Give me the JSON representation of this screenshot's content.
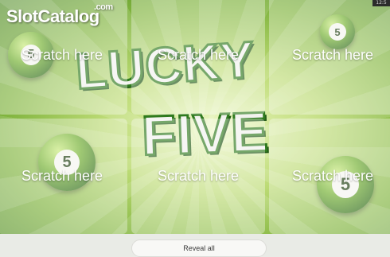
{
  "game": {
    "title_line1": "LUCKY",
    "title_line2": "FIVE",
    "ball_number": "5"
  },
  "watermark": {
    "brand": "SlotCatalog",
    "domain": ".com"
  },
  "clock": "12:5",
  "panels": [
    {
      "label": "Scratch here"
    },
    {
      "label": "Scratch here"
    },
    {
      "label": "Scratch here"
    },
    {
      "label": "Scratch here"
    },
    {
      "label": "Scratch here"
    },
    {
      "label": "Scratch here"
    }
  ],
  "controls": {
    "reveal_all": "Reveal all"
  },
  "colors": {
    "background_green": "#7fb33d",
    "title_outline": "#2f7a1e",
    "panel_overlay": "rgba(255,255,255,0.34)"
  }
}
